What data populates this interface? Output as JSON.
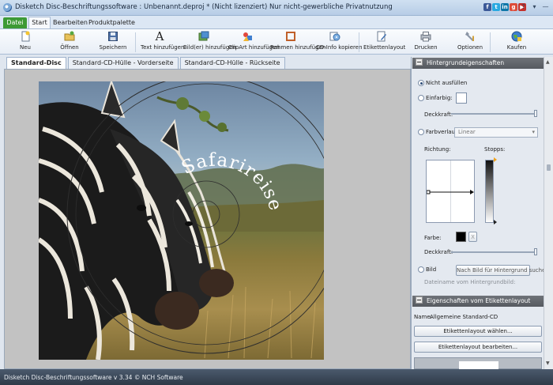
{
  "window": {
    "title": "Disketch Disc-Beschriftungssoftware : Unbenannt.deproj * (Nicht lizenziert) Nur nicht-gewerbliche Privatnutzung",
    "social": [
      "f",
      "t",
      "in",
      "g",
      "▶"
    ],
    "controls": [
      "?",
      "▾",
      "—",
      "□",
      "✕"
    ]
  },
  "menu": {
    "datei": "Datei",
    "start": "Start",
    "bearbeiten": "Bearbeiten",
    "produktpalette": "Produktpalette"
  },
  "toolbar": {
    "neu": "Neu",
    "oeffnen": "Öffnen",
    "speichern": "Speichern",
    "text": "Text hinzufügen",
    "bilder": "Bild(er) hinzufügen",
    "clipart": "ClipArt hinzufügen",
    "rahmen": "Rahmen hinzufügen",
    "cdinfo": "CD-Info kopieren",
    "layout": "Etikettenlayout",
    "drucken": "Drucken",
    "optionen": "Optionen",
    "kaufen": "Kaufen"
  },
  "doc_tabs": [
    "Standard-Disc",
    "Standard-CD-Hülle - Vorderseite",
    "Standard-CD-Hülle - Rückseite"
  ],
  "disc": {
    "text": "Safarireise"
  },
  "panel": {
    "bg_header": "Hintergrundeigenschaften",
    "opt_none": "Nicht ausfüllen",
    "opt_solid": "Einfarbig:",
    "opacity": "Deckkraft:",
    "opt_gradient": "Farbverlauf:",
    "gradient_value": "Linear",
    "direction": "Richtung:",
    "stops": "Stopps:",
    "color": "Farbe:",
    "clear": "X",
    "opt_image": "Bild",
    "image_button": "Nach Bild für Hintergrund suchen",
    "image_name_placeholder": "Dateiname vom Hintergrundbild:",
    "layout_header": "Eigenschaften vom Etikettenlayout",
    "name_label": "Name:",
    "name_value": "Allgemeine Standard-CD",
    "choose_layout": "Etikettenlayout wählen...",
    "edit_layout": "Etikettenlayout bearbeiten..."
  },
  "status": {
    "text": "Disketch Disc-Beschriftungssoftware v 3.34 © NCH Software"
  },
  "colors": {
    "accent_green": "#3d9a35",
    "title_bar": "#c3d6ec",
    "panel_header": "#5f6369"
  }
}
